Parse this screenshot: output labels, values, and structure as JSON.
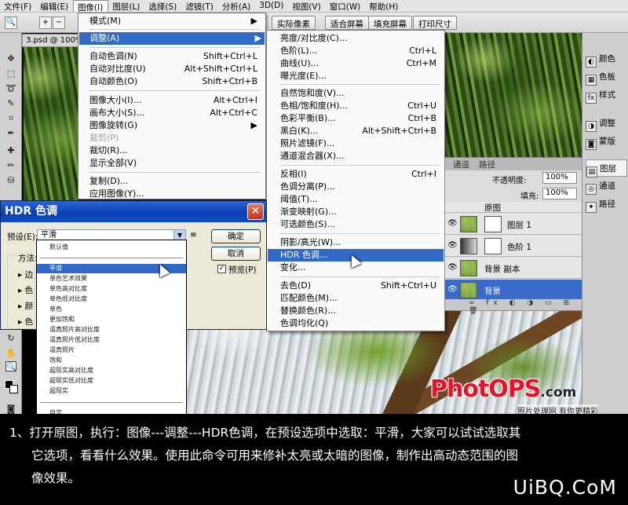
{
  "menubar": [
    "文件(F)",
    "编辑(E)",
    "图像(I)",
    "图层(L)",
    "选择(S)",
    "滤镜(T)",
    "分析(A)",
    "3D(D)",
    "视图(V)",
    "窗口(W)",
    "帮助(H)"
  ],
  "optionbar": {
    "actual_pixels": "实际像素",
    "fit_screen": "适合屏幕",
    "fill_screen": "填充屏幕",
    "print_size": "打印尺寸"
  },
  "doc_tab": "3.psd @ 100%",
  "image_menu": {
    "mode": "模式(M)",
    "adjust": "调整(A)",
    "auto_tone": "自动色调(N)",
    "auto_tone_sc": "Shift+Ctrl+L",
    "auto_contrast": "自动对比度(U)",
    "auto_contrast_sc": "Alt+Shift+Ctrl+L",
    "auto_color": "自动颜色(O)",
    "auto_color_sc": "Shift+Ctrl+B",
    "image_size": "图像大小(I)...",
    "image_size_sc": "Alt+Ctrl+I",
    "canvas_size": "画布大小(S)...",
    "canvas_size_sc": "Alt+Ctrl+C",
    "rotate": "图像旋转(G)",
    "crop": "裁剪(P)",
    "trim": "裁切(R)...",
    "reveal_all": "显示全部(V)",
    "duplicate": "复制(D)...",
    "apply_image": "应用图像(Y)..."
  },
  "adjust_menu": {
    "brightness": "亮度/对比度(C)...",
    "levels": "色阶(L)...",
    "levels_sc": "Ctrl+L",
    "curves": "曲线(U)...",
    "curves_sc": "Ctrl+M",
    "exposure": "曝光度(E)...",
    "vibrance": "自然饱和度(V)...",
    "hue_sat": "色相/饱和度(H)...",
    "hue_sat_sc": "Ctrl+U",
    "color_balance": "色彩平衡(B)...",
    "color_balance_sc": "Ctrl+B",
    "bw": "黑白(K)...",
    "bw_sc": "Alt+Shift+Ctrl+B",
    "photo_filter": "照片滤镜(F)...",
    "channel_mixer": "通道混合器(X)...",
    "invert": "反相(I)",
    "invert_sc": "Ctrl+I",
    "posterize": "色调分离(P)...",
    "threshold": "阈值(T)...",
    "gradient_map": "渐变映射(G)...",
    "selective_color": "可选颜色(S)...",
    "shadows_highlights": "阴影/高光(W)...",
    "hdr_toning": "HDR 色调...",
    "variations": "变化...",
    "desaturate": "去色(D)",
    "desaturate_sc": "Shift+Ctrl+U",
    "match_color": "匹配颜色(M)...",
    "replace_color": "替换颜色(R)...",
    "equalize": "色调均化(Q)"
  },
  "hdr_dialog": {
    "title": "HDR 色调",
    "preset_label": "预设(E):",
    "preset_value": "平滑",
    "ok": "确定",
    "cancel": "取消",
    "preview": "预览(P)",
    "method_label": "方法:",
    "side_labels": [
      "边",
      "色",
      "颜",
      "色"
    ]
  },
  "preset_list": [
    "默认值",
    "平滑",
    "单色艺术效果",
    "单色高对比度",
    "单色低对比度",
    "单色",
    "更加饱和",
    "逼真照片高对比度",
    "逼真照片低对比度",
    "逼真照片",
    "饱和",
    "超现实高对比度",
    "超现实低对比度",
    "超现实",
    "自定"
  ],
  "layers_panel": {
    "tabs": [
      "通道",
      "路径"
    ],
    "opacity_label": "不透明度:",
    "opacity": "100%",
    "fill_label": "填充:",
    "fill": "100%",
    "layers": [
      "原图",
      "图层 1",
      "色阶 1",
      "背景 副本",
      "背景"
    ]
  },
  "dock": [
    "颜色",
    "色板",
    "样式",
    "调整",
    "蒙版",
    "图层",
    "通道",
    "路径"
  ],
  "watermark": {
    "logo": "PhotOPS",
    "com": ".com",
    "tagline": "照片处理网 有你更精彩"
  },
  "caption": {
    "line1": "1、打开原图，执行：图像---调整---HDR色调，在预设选项中选取：平滑，大家可以试试选取其",
    "line2": "它选项，看看什么效果。使用此命令可用来修补太亮或太暗的图像，制作出高动态范围的图",
    "line3": "像效果。",
    "site": "UiBQ.CoM"
  }
}
